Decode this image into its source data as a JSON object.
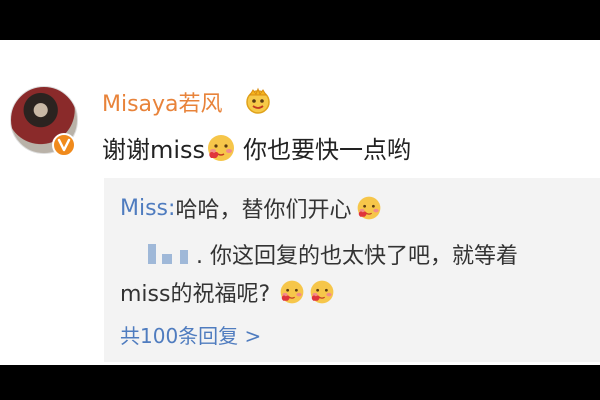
{
  "comment": {
    "username": "Misaya若风",
    "text_part1": "谢谢miss",
    "text_part2": "你也要快一点哟",
    "crown": "crown-icon",
    "verified": "verified-badge-icon"
  },
  "reply": {
    "author": "Miss:",
    "text1": "哈哈，替你们开心",
    "text2": ". 你这回复的也太快了吧，就等着",
    "text3": "miss的祝福呢?",
    "more_label": "共100条回复 >"
  },
  "colors": {
    "username": "#e8833a",
    "link": "#4f7cbf",
    "reply_bg": "#f3f3f3",
    "text": "#222222"
  }
}
